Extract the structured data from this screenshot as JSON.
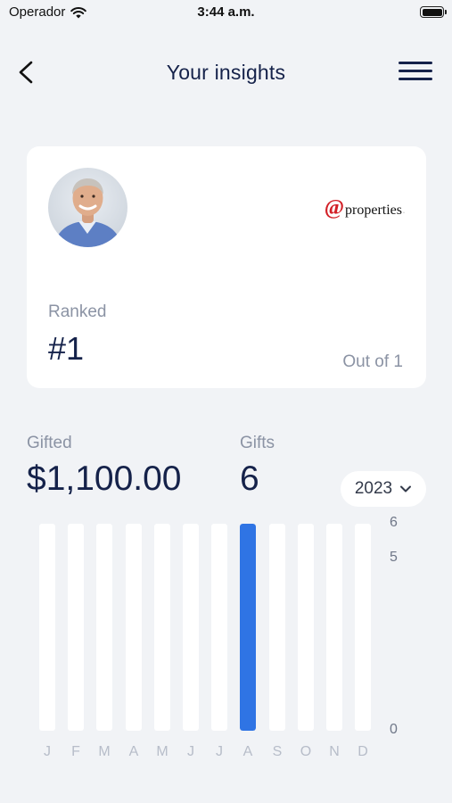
{
  "status_bar": {
    "carrier": "Operador",
    "time": "3:44 a.m.",
    "wifi_icon": "wifi-icon",
    "battery_icon": "battery-icon"
  },
  "nav": {
    "title": "Your insights",
    "back_icon": "chevron-left-icon",
    "menu_icon": "hamburger-menu-icon"
  },
  "profile_card": {
    "avatar_icon": "avatar-photo",
    "brand": {
      "at": "@",
      "name": "properties",
      "tm": "·"
    },
    "rank_label": "Ranked",
    "rank_value": "#1",
    "out_of": "Out of 1"
  },
  "stats": {
    "gifted_label": "Gifted",
    "gifted_value": "$1,100.00",
    "gifts_label": "Gifts",
    "gifts_value": "6"
  },
  "year_select": {
    "value": "2023"
  },
  "chart_data": {
    "type": "bar",
    "categories": [
      "J",
      "F",
      "M",
      "A",
      "M",
      "J",
      "J",
      "A",
      "S",
      "O",
      "N",
      "D"
    ],
    "values": [
      0,
      0,
      0,
      0,
      0,
      0,
      0,
      6,
      0,
      0,
      0,
      0
    ],
    "y_ticks": [
      "6",
      "5",
      "0"
    ],
    "ylim": [
      0,
      6
    ],
    "colors": {
      "bar": "#2f74e4",
      "track": "#ffffff"
    }
  }
}
